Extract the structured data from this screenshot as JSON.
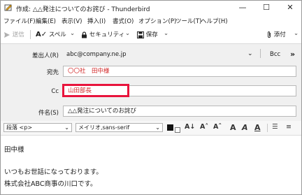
{
  "window": {
    "title": "作成: △△発注についてのお詫び - Thunderbird",
    "controls": [
      "—",
      "☐",
      "✕"
    ]
  },
  "menu": [
    "ファイル(F)",
    "編集(E)",
    "表示(V)",
    "挿入(I)",
    "書式(O)",
    "オプション(P)",
    "ツール(T)",
    "ヘルプ(H)"
  ],
  "toolbar": {
    "send": "送信",
    "spell": "スペル",
    "security": "セキュリティ",
    "save": "保存",
    "attach": "添付"
  },
  "header": {
    "from_label": "差出人(R)",
    "from_value": "abc@company.ne.jp",
    "bcc": "Bcc",
    "to_label": "宛先",
    "to_value": "〇〇社　田中様",
    "cc_label": "Cc",
    "cc_value": "山田部長",
    "subject_label": "件名(S)",
    "subject_value": "△△発注についてのお詫び"
  },
  "format": {
    "paragraph": "段落 <p>",
    "font": "メイリオ,sans-serif"
  },
  "body": [
    "田中様",
    "いつもお世話になっております。",
    "株式会社ABC商事の川口です。"
  ],
  "colors": {
    "highlight": "#e8143c",
    "recipient_text": "#d22828"
  }
}
